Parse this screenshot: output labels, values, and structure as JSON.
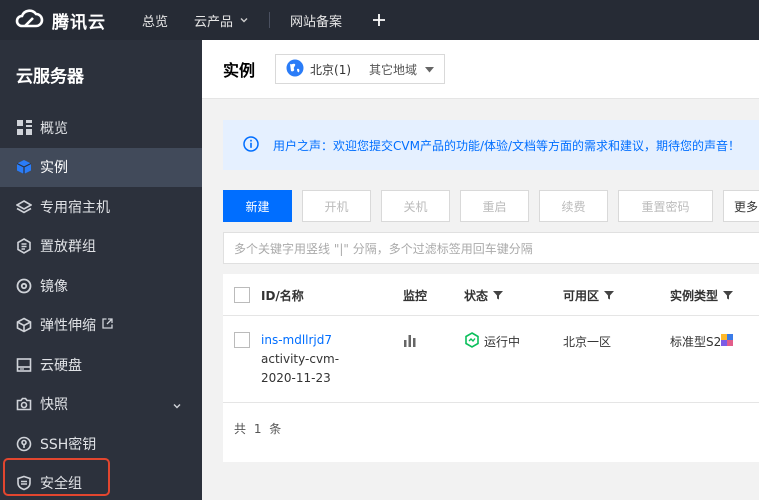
{
  "brand": {
    "name": "腾讯云",
    "color": "#ffffff",
    "icon": "cloud-icon"
  },
  "topnav": {
    "items": [
      {
        "label": "总览"
      },
      {
        "label": "云产品"
      },
      {
        "label": "网站备案"
      }
    ],
    "add_icon": "plus-icon"
  },
  "sidebar": {
    "title": "云服务器",
    "items": [
      {
        "label": "概览",
        "icon": "grid-icon"
      },
      {
        "label": "实例",
        "icon": "cube-icon",
        "active": true
      },
      {
        "label": "专用宿主机",
        "icon": "layers-icon"
      },
      {
        "label": "置放群组",
        "icon": "hexagon-icon"
      },
      {
        "label": "镜像",
        "icon": "disc-icon"
      },
      {
        "label": "弹性伸缩",
        "icon": "box-icon",
        "external": true
      },
      {
        "label": "云硬盘",
        "icon": "disk-icon"
      },
      {
        "label": "快照",
        "icon": "camera-icon",
        "expandable": true
      },
      {
        "label": "SSH密钥",
        "icon": "key-icon"
      },
      {
        "label": "安全组",
        "icon": "shield-icon",
        "highlighted": true
      }
    ],
    "highlight_color": "#e2462f"
  },
  "header": {
    "title": "实例",
    "region": {
      "current": "北京(1)",
      "other": "其它地域"
    }
  },
  "notice": {
    "text": "用户之声：欢迎您提交CVM产品的功能/体验/文档等方面的需求和建议，期待您的声音！"
  },
  "toolbar": {
    "buttons": [
      {
        "label": "新建",
        "primary": true
      },
      {
        "label": "开机"
      },
      {
        "label": "关机"
      },
      {
        "label": "重启"
      },
      {
        "label": "续费"
      },
      {
        "label": "重置密码"
      },
      {
        "label": "更多"
      }
    ]
  },
  "search": {
    "placeholder": "多个关键字用竖线 \"|\" 分隔，多个过滤标签用回车键分隔"
  },
  "table": {
    "headers": [
      "ID/名称",
      "监控",
      "状态",
      "可用区",
      "实例类型"
    ],
    "rows": [
      {
        "id": "ins-mdllrjd7",
        "name": "activity-cvm-2020-11-23",
        "status": "运行中",
        "zone": "北京一区",
        "type": "标准型S2"
      }
    ],
    "footer": "共 1 条"
  },
  "colors": {
    "accent": "#006eff",
    "running": "#0abf5b"
  }
}
